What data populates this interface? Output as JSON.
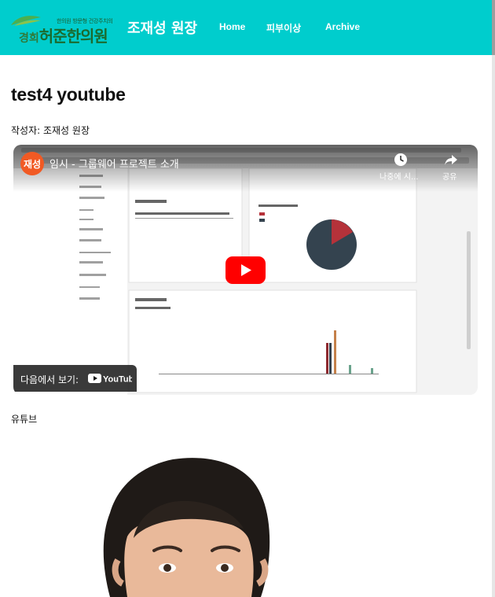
{
  "header": {
    "logo_small_text": "한의원 방문형 건강주치의",
    "logo_region": "경희",
    "logo_brand": "허준",
    "logo_suffix": "한의원",
    "site_title": "조재성 원장",
    "nav": [
      {
        "label": "Home"
      },
      {
        "label": "피부이상"
      },
      {
        "label": "Archive"
      }
    ],
    "background_color": "#00cdcd"
  },
  "post": {
    "title": "test4 youtube",
    "author_line": "작성자: 조재성 원장",
    "caption": "유튜브"
  },
  "video": {
    "channel_avatar_text": "재성",
    "title": "임시 - 그룹웨어 프로젝트 소개",
    "watch_later_label": "나중에 시...",
    "share_label": "공유",
    "watch_on_label": "다음에서 보기:",
    "youtube_wordmark": "YouTube",
    "icons": [
      "clock-icon",
      "share-icon",
      "play-icon",
      "youtube-logo-icon"
    ]
  }
}
